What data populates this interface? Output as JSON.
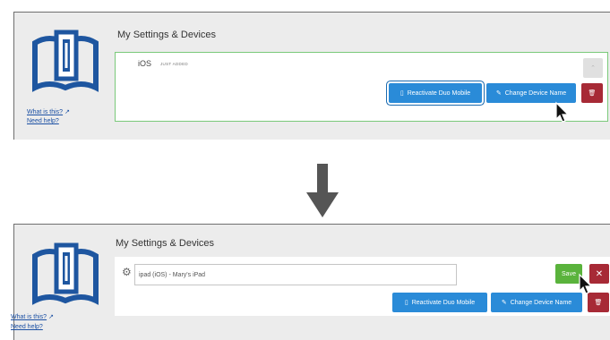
{
  "panels": {
    "top": {
      "title": "My Settings & Devices",
      "links": {
        "what_is_this": "What is this?",
        "need_help": "Need help?"
      },
      "device": {
        "os_icon": "apple-icon",
        "os_name": "iOS",
        "badge": "JUST ADDED"
      },
      "buttons": {
        "reactivate": "Reactivate Duo Mobile",
        "change_name": "Change Device Name"
      }
    },
    "bottom": {
      "title": "My Settings & Devices",
      "links": {
        "what_is_this": "What is this?",
        "need_help": "Need help?"
      },
      "device": {
        "os_icon": "android-icon",
        "input_value": "ipad (iOS) - Mary's iPad"
      },
      "buttons": {
        "save": "Save",
        "reactivate": "Reactivate Duo Mobile",
        "change_name": "Change Device Name"
      }
    }
  },
  "colors": {
    "button_blue": "#2a8bd8",
    "button_red": "#a72a36",
    "button_green": "#5ab33c",
    "new_device_border": "#7ac97a",
    "logo_blue": "#1e56a0",
    "link_blue": "#1a4fa3"
  }
}
